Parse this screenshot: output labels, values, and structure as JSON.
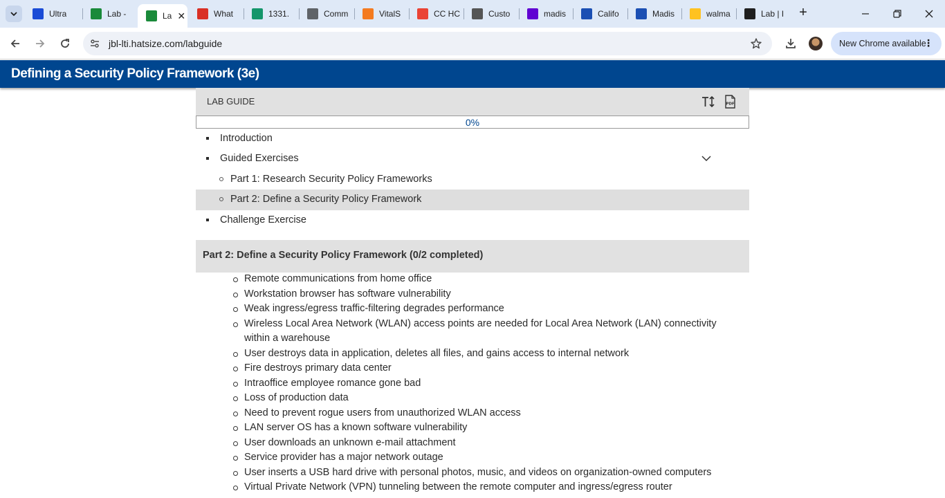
{
  "browser": {
    "tabs": [
      {
        "label": "Ultra",
        "icon": "anthology-icon",
        "color": "#1a4bd6"
      },
      {
        "label": "Lab -",
        "icon": "jbl-icon",
        "color": "#1a8a3a"
      },
      {
        "label": "La",
        "icon": "jbl-icon",
        "color": "#1a8a3a",
        "active": true
      },
      {
        "label": "What",
        "icon": "cio-icon",
        "color": "#d93025"
      },
      {
        "label": "1331.",
        "icon": "spreadsheet-icon",
        "color": "#14966b"
      },
      {
        "label": "Comm",
        "icon": "globe-icon",
        "color": "#5f6368"
      },
      {
        "label": "VitalS",
        "icon": "vitalsource-icon",
        "color": "#f47b20"
      },
      {
        "label": "CC HC",
        "icon": "gmail-icon",
        "color": "#ea4335"
      },
      {
        "label": "Custo",
        "icon": "slash-icon",
        "color": "#555"
      },
      {
        "label": "madis",
        "icon": "yahoo-icon",
        "color": "#6001d2"
      },
      {
        "label": "Califo",
        "icon": "bing-b-icon",
        "color": "#1b4fb3"
      },
      {
        "label": "Madis",
        "icon": "bing-b-icon",
        "color": "#1b4fb3"
      },
      {
        "label": "walma",
        "icon": "walmart-icon",
        "color": "#ffc220"
      },
      {
        "label": "Lab | I",
        "icon": "chatgpt-icon",
        "color": "#1f1f1f"
      }
    ],
    "url": "jbl-lti.hatsize.com/labguide",
    "update_label": "New Chrome available"
  },
  "page": {
    "title": "Defining a Security Policy Framework (3e)"
  },
  "lab_guide": {
    "header": "LAB GUIDE",
    "progress": 0,
    "progress_label": "0%",
    "toc": {
      "introduction": "Introduction",
      "guided": "Guided Exercises",
      "part1": "Part 1: Research Security Policy Frameworks",
      "part2": "Part 2: Define a Security Policy Framework",
      "challenge": "Challenge Exercise"
    },
    "section_title": "Part 2: Define a Security Policy Framework (0/2 completed)",
    "items": [
      "Remote communications from home office",
      "Workstation browser has software vulnerability",
      "Weak ingress/egress traffic-filtering degrades performance",
      "Wireless Local Area Network (WLAN) access points are needed for Local Area Network (LAN) connectivity within a warehouse",
      "User destroys data in application, deletes all files, and gains access to internal network",
      "Fire destroys primary data center",
      "Intraoffice employee romance gone bad",
      "Loss of production data",
      "Need to prevent rogue users from unauthorized WLAN access",
      "LAN server OS has a known software vulnerability",
      "User downloads an unknown e-mail attachment",
      "Service provider has a major network outage",
      "User inserts a USB hard drive with personal photos, music, and videos on organization-owned computers",
      "Virtual Private Network (VPN) tunneling between the remote computer and ingress/egress router"
    ]
  }
}
